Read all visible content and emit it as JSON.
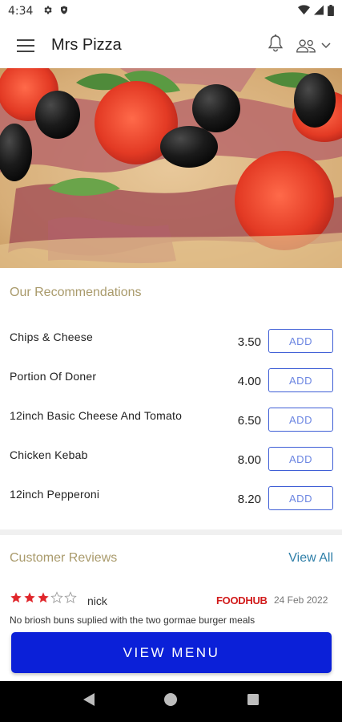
{
  "status_bar": {
    "time": "4:34",
    "icons": [
      "gear-icon",
      "shield-icon",
      "wifi-icon",
      "signal-icon",
      "battery-icon"
    ]
  },
  "app_bar": {
    "title": "Mrs Pizza",
    "icons": [
      "hamburger-menu-icon",
      "bell-icon",
      "group-icon",
      "chevron-down-icon"
    ]
  },
  "hero": {
    "description_icon": "pizza-image"
  },
  "recommendations": {
    "title": "Our Recommendations",
    "add_label": "ADD",
    "items": [
      {
        "name": "Chips & Cheese",
        "price": "3.50"
      },
      {
        "name": "Portion Of Doner",
        "price": "4.00"
      },
      {
        "name": "12inch Basic Cheese And Tomato",
        "price": "6.50"
      },
      {
        "name": "Chicken Kebab",
        "price": "8.00"
      },
      {
        "name": "12inch Pepperoni",
        "price": "8.20"
      }
    ]
  },
  "reviews": {
    "title": "Customer Reviews",
    "view_all": "View All",
    "items": [
      {
        "rating": 3,
        "max_rating": 5,
        "reviewer": "nick",
        "source": "FOODHUB",
        "date": "24 Feb 2022",
        "text": "No briosh buns suplied with the two gormae burger meals"
      }
    ]
  },
  "cta": {
    "label": "VIEW MENU"
  },
  "colors": {
    "accent": "#0b20d8",
    "section_title": "#a99a6b",
    "link": "#2f7fa8",
    "star": "#e0262b",
    "brand_red": "#d11b1b"
  }
}
